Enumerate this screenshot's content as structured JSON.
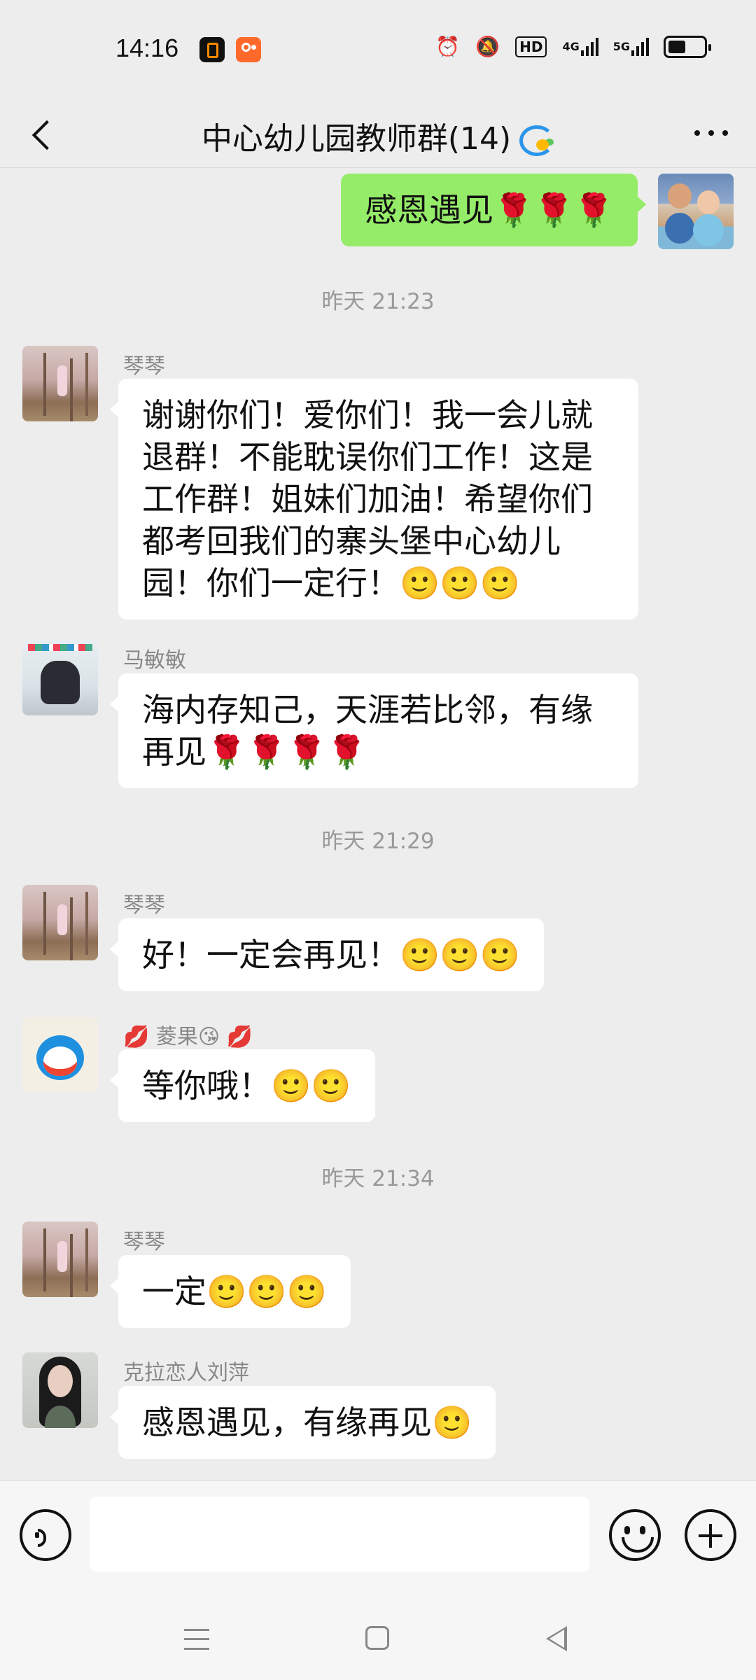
{
  "status_bar": {
    "time": "14:16",
    "hd_label": "HD",
    "net1_label": "4G",
    "net2_label": "5G"
  },
  "header": {
    "title": "中心幼儿园教师群(14)"
  },
  "messages": [
    {
      "type": "self",
      "text": "感恩遇见🌹🌹🌹"
    },
    {
      "type": "time",
      "text": "昨天 21:23"
    },
    {
      "type": "other",
      "sender": "琴琴",
      "text": "谢谢你们！爱你们！我一会儿就退群！不能耽误你们工作！这是工作群！姐妹们加油！希望你们都考回我们的寨头堡中心幼儿园！你们一定行！🙂🙂🙂"
    },
    {
      "type": "other",
      "sender": "马敏敏",
      "text": "海内存知己，天涯若比邻，有缘再见🌹🌹🌹🌹"
    },
    {
      "type": "time",
      "text": "昨天 21:29"
    },
    {
      "type": "other",
      "sender": "琴琴",
      "text": "好！一定会再见！🙂🙂🙂"
    },
    {
      "type": "other",
      "sender": "💋 菱果😘 💋",
      "text": "等你哦！🙂🙂"
    },
    {
      "type": "time",
      "text": "昨天 21:34"
    },
    {
      "type": "other",
      "sender": "琴琴",
      "text": "一定🙂🙂🙂"
    },
    {
      "type": "other",
      "sender": "克拉恋人刘萍",
      "text": "感恩遇见，有缘再见🙂"
    }
  ]
}
